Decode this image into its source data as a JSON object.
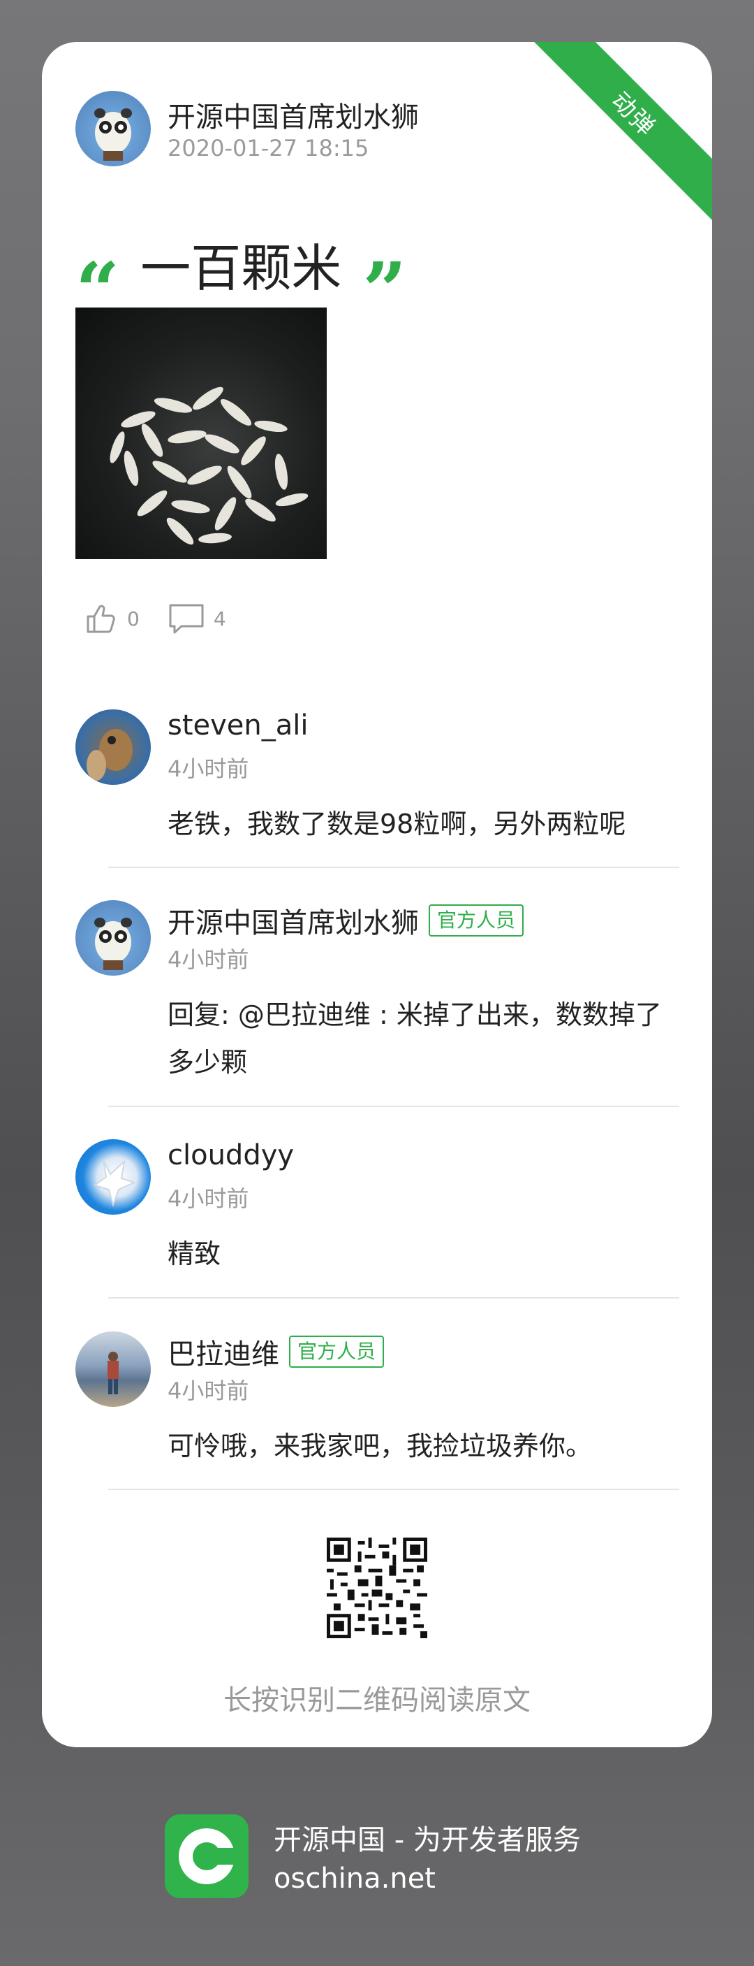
{
  "ribbon_label": "动弹",
  "author": {
    "name": "开源中国首席划水狮",
    "date": "2020-01-27 18:15"
  },
  "post": {
    "title": "一百颗米",
    "image_alt": "rice grains on dark leather"
  },
  "stats": {
    "likes": "0",
    "comments": "4"
  },
  "comments": [
    {
      "name": "steven_ali",
      "badge": "",
      "time": "4小时前",
      "text": "老铁，我数了数是98粒啊，另外两粒呢",
      "avatar": "squirrel-avatar"
    },
    {
      "name": "开源中国首席划水狮",
      "badge": "官方人员",
      "time": "4小时前",
      "text": "回复: @巴拉迪维 : 米掉了出来，数数掉了多少颗",
      "avatar": "panda-avatar"
    },
    {
      "name": "clouddyy",
      "badge": "",
      "time": "4小时前",
      "text": "精致",
      "avatar": "cat-avatar"
    },
    {
      "name": "巴拉迪维",
      "badge": "官方人员",
      "time": "4小时前",
      "text": "可怜哦，来我家吧，我捡垃圾养你。",
      "avatar": "person-avatar"
    }
  ],
  "qr_caption": "长按识别二维码阅读原文",
  "footer": {
    "title": "开源中国 - 为开发者服务",
    "url": "oschina.net"
  },
  "colors": {
    "accent": "#2fae4a",
    "text": "#222222",
    "muted": "#9a9a9a"
  }
}
